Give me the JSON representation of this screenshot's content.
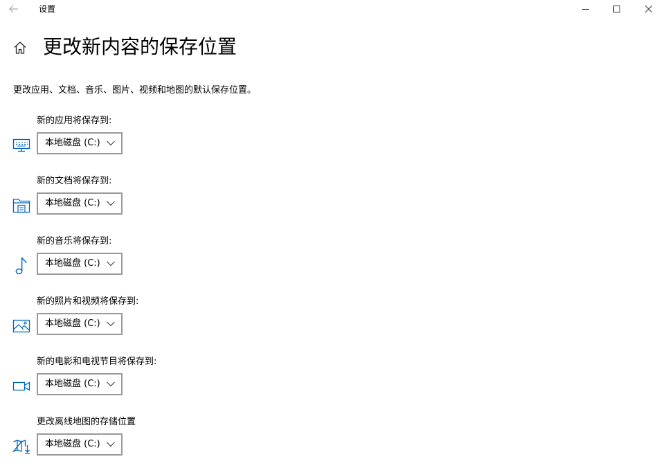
{
  "window": {
    "title": "设置",
    "icons": {
      "back": "back-arrow-icon",
      "minimize": "minimize-icon",
      "maximize": "maximize-icon",
      "close": "close-icon"
    }
  },
  "header": {
    "home_icon": "home-icon",
    "title": "更改新内容的保存位置"
  },
  "description": "更改应用、文档、音乐、图片、视频和地图的默认保存位置。",
  "accent_color": "#0067c0",
  "settings": [
    {
      "label": "新的应用将保存到:",
      "value": "本地磁盘 (C:)",
      "icon": "apps-monitor-icon"
    },
    {
      "label": "新的文档将保存到:",
      "value": "本地磁盘 (C:)",
      "icon": "documents-folder-icon"
    },
    {
      "label": "新的音乐将保存到:",
      "value": "本地磁盘 (C:)",
      "icon": "music-note-icon"
    },
    {
      "label": "新的照片和视频将保存到:",
      "value": "本地磁盘 (C:)",
      "icon": "photo-icon"
    },
    {
      "label": "新的电影和电视节目将保存到:",
      "value": "本地磁盘 (C:)",
      "icon": "video-camera-icon"
    },
    {
      "label": "更改离线地图的存储位置",
      "value": "本地磁盘 (C:)",
      "icon": "map-download-icon"
    }
  ]
}
